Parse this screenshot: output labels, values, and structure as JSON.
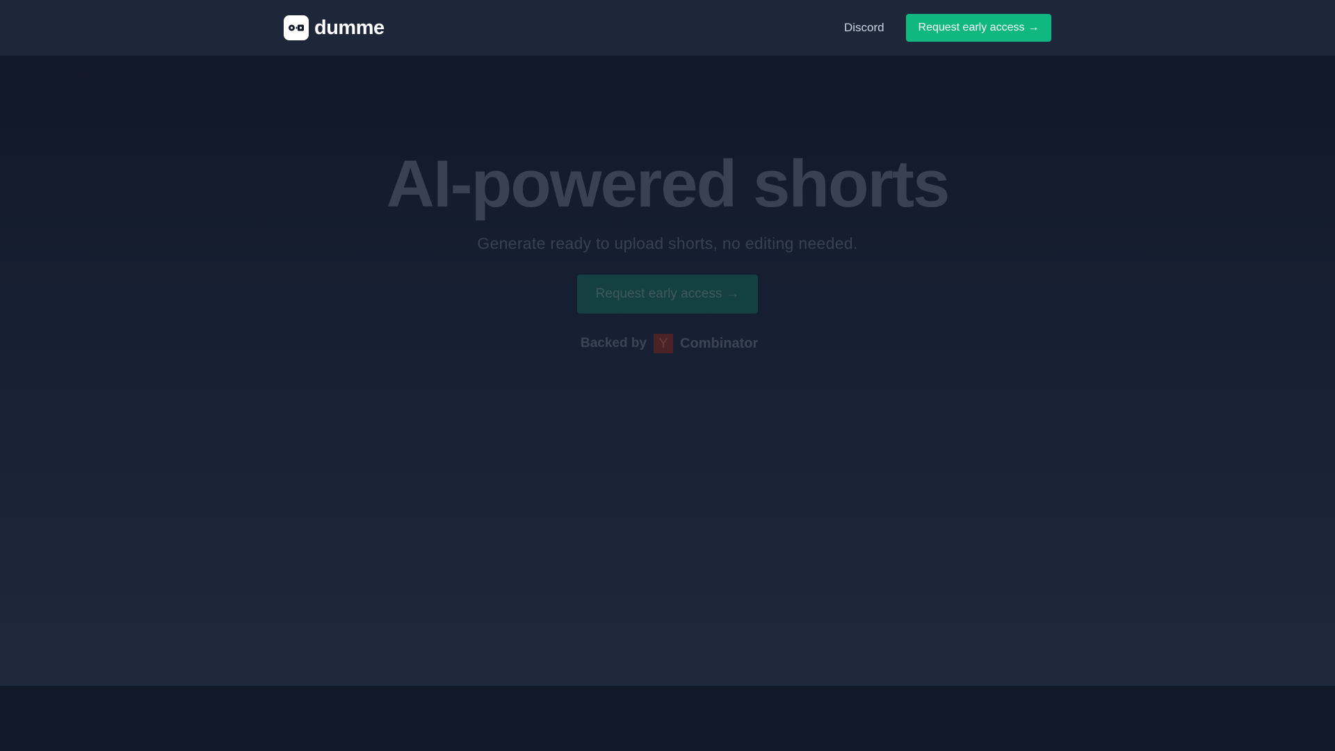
{
  "header": {
    "brand_name": "dumme",
    "discord_label": "Discord",
    "cta_label": "Request early access",
    "cta_arrow": "→"
  },
  "hero": {
    "title": "AI-powered shorts",
    "subtitle": "Generate ready to upload shorts, no editing needed.",
    "cta_label": "Request early access",
    "cta_arrow": "→",
    "backed_by_label": "Backed by",
    "backer_logo_letter": "Y",
    "backer_name": "Combinator"
  },
  "colors": {
    "accent": "#10b77f",
    "nav_background": "#1e263a",
    "page_background": "#111827",
    "yc_logo": "#4b2326"
  },
  "icons": {
    "brand": "robot-face-icon",
    "arrow": "arrow-right-icon"
  }
}
